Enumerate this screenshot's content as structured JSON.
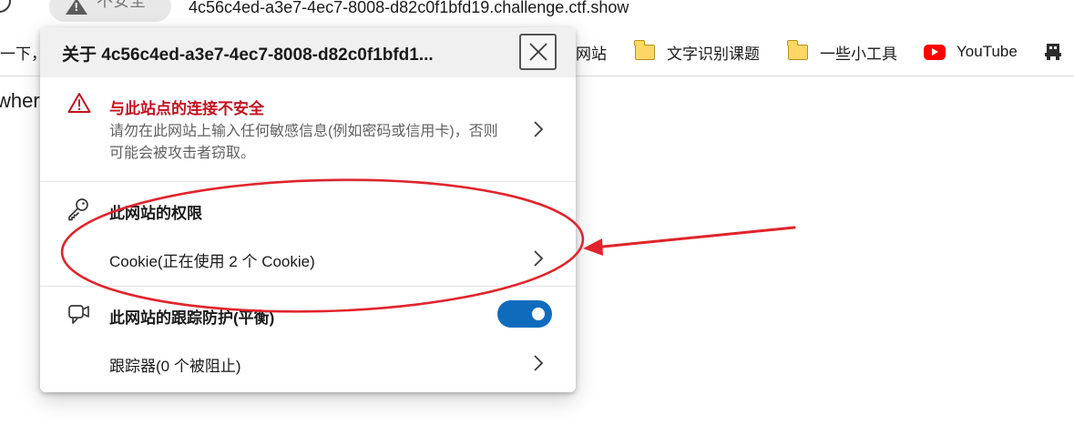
{
  "address_bar": {
    "security_chip_label": "不安全",
    "url": "4c56c4ed-a3e7-4ec7-8008-d82c0f1bfd19.challenge.ctf.show"
  },
  "bookmarks": {
    "partial_left": "一下，",
    "items": [
      {
        "label": "网站",
        "icon": "folder-icon"
      },
      {
        "label": "文字识别课题",
        "icon": "folder-icon"
      },
      {
        "label": "一些小工具",
        "icon": "folder-icon"
      },
      {
        "label": "YouTube",
        "icon": "youtube-icon"
      }
    ]
  },
  "page": {
    "text_fragment": "wher"
  },
  "popup": {
    "title": "关于 4c56c4ed-a3e7-4ec7-8008-d82c0f1bfd1...",
    "insecure": {
      "title": "与此站点的连接不安全",
      "description": "请勿在此网站上输入任何敏感信息(例如密码或信用卡)，否则可能会被攻击者窃取。"
    },
    "permissions": {
      "title": "此网站的权限",
      "cookie_row": "Cookie(正在使用 2 个 Cookie)"
    },
    "tracking": {
      "title": "此网站的跟踪防护(平衡)",
      "toggle_on": true,
      "trackers_row": "跟踪器(0 个被阻止)"
    }
  },
  "colors": {
    "warning_red": "#c50f1f",
    "toggle_blue": "#0f6cbd",
    "annotation_red": "#e0242b"
  }
}
